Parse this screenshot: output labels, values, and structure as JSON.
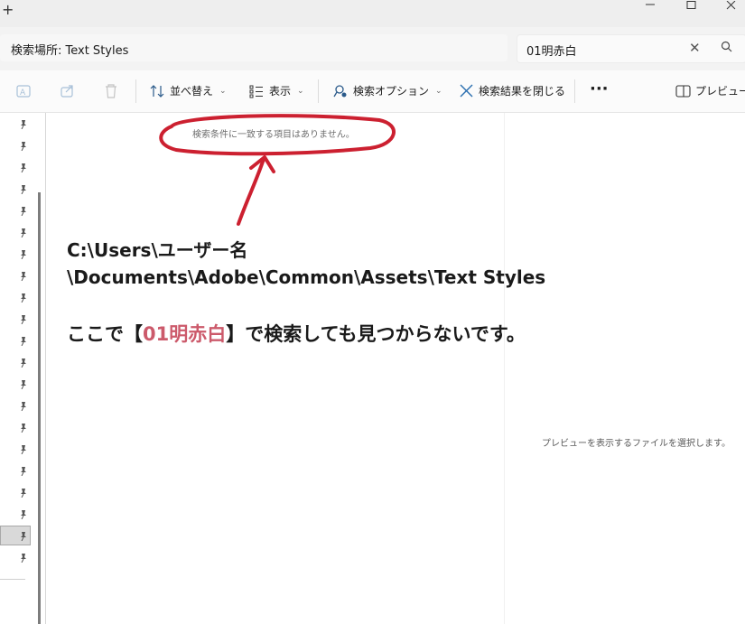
{
  "window": {
    "new_tab_label": "+",
    "controls": [
      "minimize-icon",
      "maximize-icon",
      "close-icon"
    ]
  },
  "address": {
    "text": "検索場所: Text Styles"
  },
  "search": {
    "value": "01明赤白",
    "clear_icon": "close-icon",
    "search_icon": "search-icon"
  },
  "toolbar": {
    "sort_label": "並べ替え",
    "view_label": "表示",
    "search_options_label": "検索オプション",
    "close_search_label": "検索結果を閉じる",
    "more_label": "···",
    "preview_label": "プレビュー"
  },
  "content": {
    "no_results": "検索条件に一致する項目はありません。",
    "preview_message": "プレビューを表示するファイルを選択します。"
  },
  "annotation": {
    "path_line1": "C:\\Users\\ユーザー名",
    "path_line2": "\\Documents\\Adobe\\Common\\Assets\\Text Styles",
    "message_before": "ここで【",
    "message_highlight": "01明赤白",
    "message_after": "】で検索しても見つからないです。",
    "accent_color": "#cc2030",
    "highlight_color": "#cc5a6b"
  },
  "nav": {
    "pinned_count": 21
  }
}
